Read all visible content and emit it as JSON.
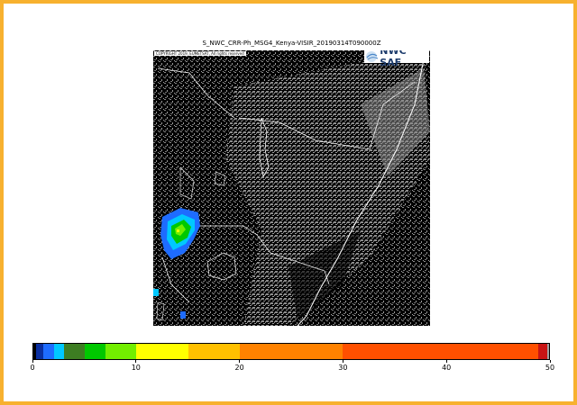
{
  "title": "S_NWC_CRR-Ph_MSG4_Kenya-VISIR_20190314T090000Z",
  "copyright": "COPYRIGHT 2019, EUMETSAT, All rights reserved",
  "logo": {
    "text": "NWC SAF",
    "icon": "nwcsaf-logo-icon"
  },
  "colorbar": {
    "min": 0,
    "max": 50,
    "segments": [
      {
        "from": 0,
        "to": 0.3,
        "color": "#000000"
      },
      {
        "from": 0.3,
        "to": 1,
        "color": "#0a2fa0"
      },
      {
        "from": 1,
        "to": 2,
        "color": "#1e6cff"
      },
      {
        "from": 2,
        "to": 3,
        "color": "#00c8ff"
      },
      {
        "from": 3,
        "to": 5,
        "color": "#3d7d22"
      },
      {
        "from": 5,
        "to": 7,
        "color": "#00c800"
      },
      {
        "from": 7,
        "to": 10,
        "color": "#72ee00"
      },
      {
        "from": 10,
        "to": 15,
        "color": "#ffff00"
      },
      {
        "from": 15,
        "to": 20,
        "color": "#ffc000"
      },
      {
        "from": 20,
        "to": 30,
        "color": "#ff8200"
      },
      {
        "from": 30,
        "to": 49,
        "color": "#ff5000"
      },
      {
        "from": 49,
        "to": 49.8,
        "color": "#c81414"
      },
      {
        "from": 49.8,
        "to": 50,
        "color": "#a0a0a0"
      }
    ],
    "ticks": [
      {
        "value": 0,
        "label": "0"
      },
      {
        "value": 10,
        "label": "10"
      },
      {
        "value": 20,
        "label": "20"
      },
      {
        "value": 30,
        "label": "30"
      },
      {
        "value": 40,
        "label": "40"
      },
      {
        "value": 50,
        "label": "50"
      }
    ]
  }
}
